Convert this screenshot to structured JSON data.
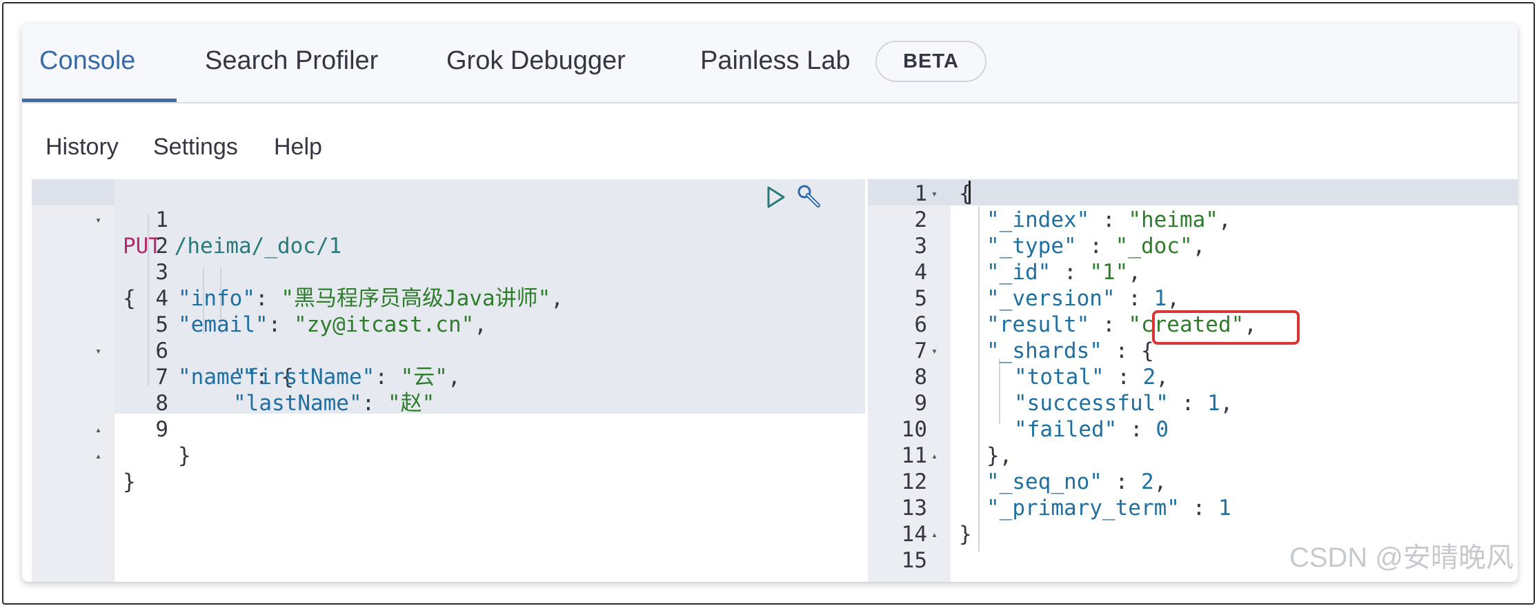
{
  "tabs": [
    {
      "label": "Console",
      "active": true
    },
    {
      "label": "Search Profiler",
      "active": false
    },
    {
      "label": "Grok Debugger",
      "active": false
    },
    {
      "label": "Painless Lab",
      "active": false
    }
  ],
  "beta_badge": "BETA",
  "menu": [
    "History",
    "Settings",
    "Help"
  ],
  "request": {
    "method": "PUT",
    "path": "/heima/_doc/1",
    "lines": [
      "1",
      "2",
      "3",
      "4",
      "5",
      "6",
      "7",
      "8",
      "9"
    ],
    "open_brace": "{",
    "info_key": "\"info\"",
    "info_value": "\"黑马程序员高级Java讲师\"",
    "email_key": "\"email\"",
    "email_value": "\"zy@itcast.cn\"",
    "name_key": "\"name\"",
    "firstName_key": "\"firstName\"",
    "firstName_value": "\"云\"",
    "lastName_key": "\"lastName\"",
    "lastName_value": "\"赵\"",
    "close_inner": "}",
    "close_brace": "}"
  },
  "response": {
    "lines": [
      "1",
      "2",
      "3",
      "4",
      "5",
      "6",
      "7",
      "8",
      "9",
      "10",
      "11",
      "12",
      "13",
      "14",
      "15"
    ],
    "index_key": "\"_index\"",
    "index_value": "\"heima\"",
    "type_key": "\"_type\"",
    "type_value": "\"_doc\"",
    "id_key": "\"_id\"",
    "id_value": "\"1\"",
    "version_key": "\"_version\"",
    "version_value": "1",
    "result_key": "\"result\"",
    "result_value": "\"created\"",
    "shards_key": "\"_shards\"",
    "total_key": "\"total\"",
    "total_value": "2",
    "successful_key": "\"successful\"",
    "successful_value": "1",
    "failed_key": "\"failed\"",
    "failed_value": "0",
    "seq_no_key": "\"_seq_no\"",
    "seq_no_value": "2",
    "primary_term_key": "\"_primary_term\"",
    "primary_term_value": "1"
  },
  "watermark": "CSDN @安晴晚风",
  "colors": {
    "accent": "#3b6ba6",
    "highlight_box": "#d93636"
  }
}
